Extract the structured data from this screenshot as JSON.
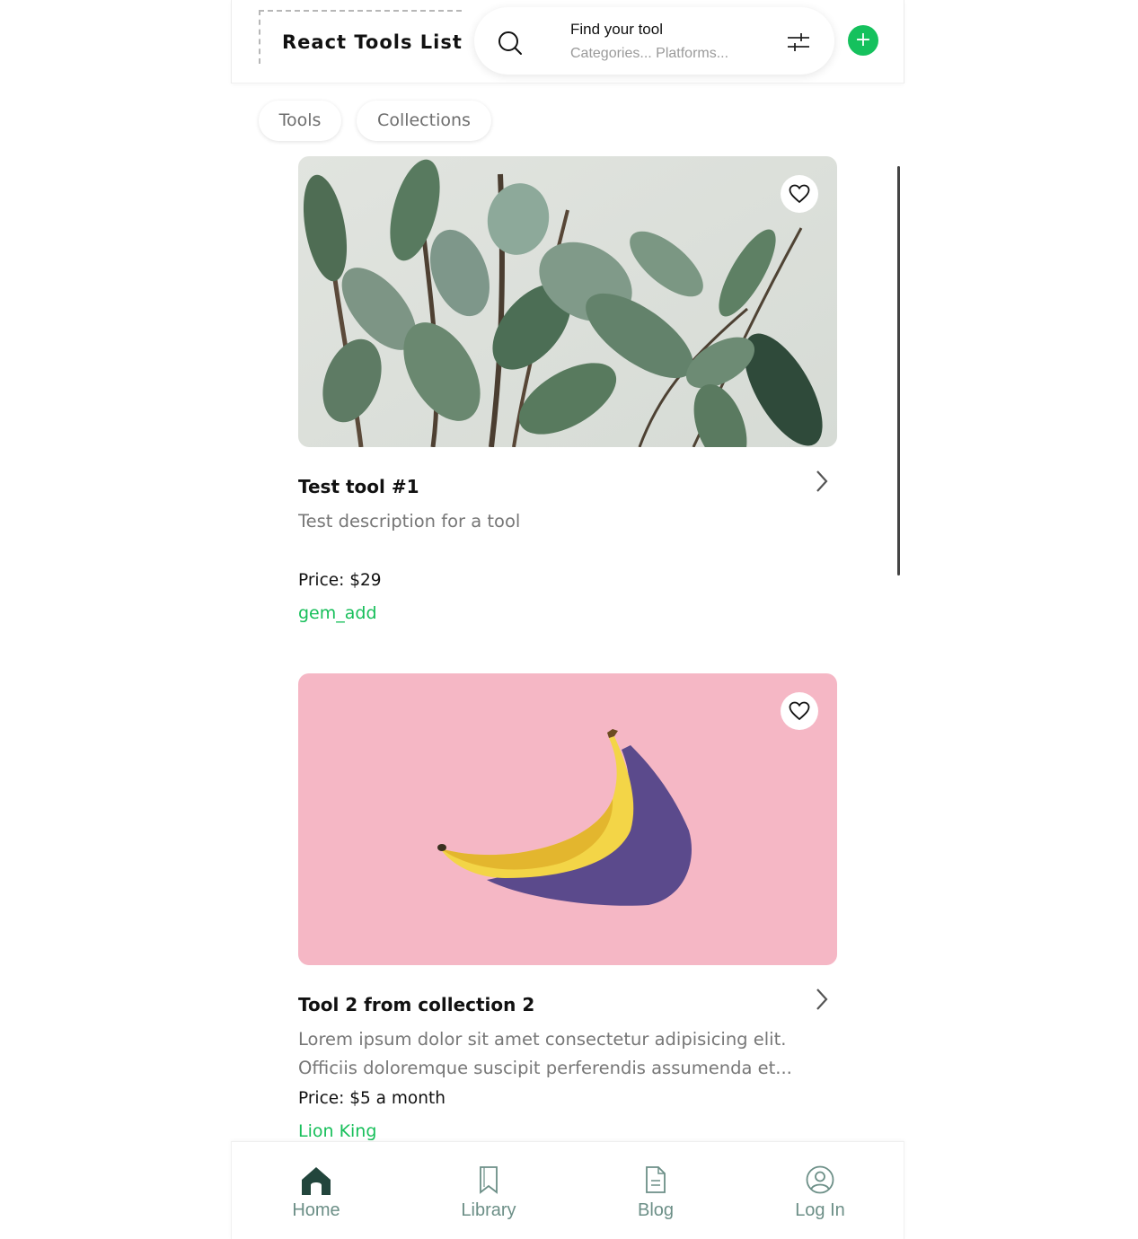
{
  "header": {
    "logo_text": "React Tools List",
    "search_title": "Find your tool",
    "search_subtitle": "Categories... Platforms...",
    "add_label": "+"
  },
  "tabs": [
    {
      "label": "Tools"
    },
    {
      "label": "Collections"
    }
  ],
  "cards": [
    {
      "title": "Test tool #1",
      "description_lines": [
        "Test description for a tool"
      ],
      "price": "Price: $29",
      "tag": "gem_add",
      "image": "plant"
    },
    {
      "title": "Tool 2 from collection 2",
      "description_lines": [
        "Lorem ipsum dolor sit amet consectetur adipisicing elit.",
        "Officiis doloremque suscipit perferendis assumenda et..."
      ],
      "price": "Price: $5 a month",
      "tag": "Lion King",
      "image": "banana"
    }
  ],
  "bottom_nav": [
    {
      "label": "Home",
      "icon": "home-icon",
      "active": true
    },
    {
      "label": "Library",
      "icon": "bookmark-icon",
      "active": false
    },
    {
      "label": "Blog",
      "icon": "document-icon",
      "active": false
    },
    {
      "label": "Log In",
      "icon": "user-circle-icon",
      "active": false
    }
  ],
  "colors": {
    "accent": "#15c15d",
    "tag": "#17bf5a",
    "nav_inactive": "#6c8f87",
    "nav_active_icon": "#22453c",
    "banana_bg": "#f5b7c5"
  }
}
